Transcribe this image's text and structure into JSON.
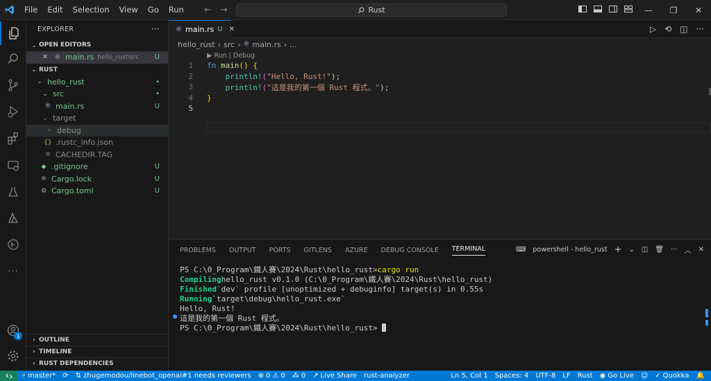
{
  "menu": [
    "File",
    "Edit",
    "Selection",
    "View",
    "Go",
    "Run"
  ],
  "command_center": "Rust",
  "explorer": {
    "title": "EXPLORER",
    "more": "···",
    "open_editors_label": "OPEN EDITORS",
    "open_editor": {
      "name": "main.rs",
      "path": "hello_rust\\src",
      "status": "U"
    },
    "workspace_label": "RUST",
    "tree": [
      {
        "name": "hello_rust",
        "status": "•"
      },
      {
        "name": "src",
        "status": "•"
      },
      {
        "name": "main.rs",
        "status": "U"
      },
      {
        "name": "target",
        "status": ""
      },
      {
        "name": "debug",
        "status": ""
      },
      {
        "name": ".rustc_info.json",
        "status": ""
      },
      {
        "name": "CACHEDIR.TAG",
        "status": ""
      },
      {
        "name": ".gitignore",
        "status": "U"
      },
      {
        "name": "Cargo.lock",
        "status": "U"
      },
      {
        "name": "Cargo.toml",
        "status": "U"
      }
    ],
    "bottom_sections": [
      "OUTLINE",
      "TIMELINE",
      "RUST DEPENDENCIES"
    ]
  },
  "accounts_badge": "1",
  "editor": {
    "tab": {
      "name": "main.rs",
      "status": "U"
    },
    "breadcrumb": [
      "hello_rust",
      "src",
      "main.rs",
      "..."
    ],
    "codelens": "▶ Run | Debug",
    "line_numbers": [
      "1",
      "2",
      "3",
      "4",
      "5"
    ],
    "code": {
      "l1_kw": "fn",
      "l1_fn": "main",
      "l1_rest": "() {",
      "l2_macro": "println!",
      "l2_open": "(",
      "l2_str": "\"Hello, Rust!\"",
      "l2_close": ");",
      "l3_macro": "println!",
      "l3_open": "(",
      "l3_str": "\"這是我的第一個 Rust 程式。\"",
      "l3_close": ");",
      "l4": "}"
    }
  },
  "panel": {
    "tabs": [
      "PROBLEMS",
      "OUTPUT",
      "PORTS",
      "GITLENS",
      "AZURE",
      "DEBUG CONSOLE",
      "TERMINAL"
    ],
    "terminal_name": "powershell - hello_rust",
    "terminal": {
      "prompt1": "PS C:\\0_Program\\鐵人賽\\2024\\Rust\\hello_rust>",
      "cmd": "cargo run",
      "compiling_label": "Compiling",
      "compiling_text": "hello_rust v0.1.0 (C:\\0_Program\\鐵人賽\\2024\\Rust\\hello_rust)",
      "finished_label": "Finished",
      "finished_text": "`dev` profile [unoptimized + debuginfo] target(s) in 0.55s",
      "running_label": "Running",
      "running_text": "`target\\debug\\hello_rust.exe`",
      "out1": "Hello, Rust!",
      "out2": "這是我的第一個 Rust 程式。",
      "prompt2": "PS C:\\0_Program\\鐵人賽\\2024\\Rust\\hello_rust>"
    }
  },
  "status": {
    "branch": "master*",
    "pr": "zhugemodou/linebot_openai#1 needs reviewers",
    "errors": "0",
    "warnings": "0",
    "ports": "0",
    "live_share": "Live Share",
    "analyzer": "rust-analyzer",
    "position": "Ln 5, Col 1",
    "spaces": "Spaces: 4",
    "encoding": "UTF-8",
    "eol": "LF",
    "language": "Rust",
    "go_live": "Go Live",
    "quokka": "Quokka"
  },
  "colors": {
    "accent": "#0078d4",
    "status_bar": "#0078d4",
    "untracked": "#73c991"
  }
}
